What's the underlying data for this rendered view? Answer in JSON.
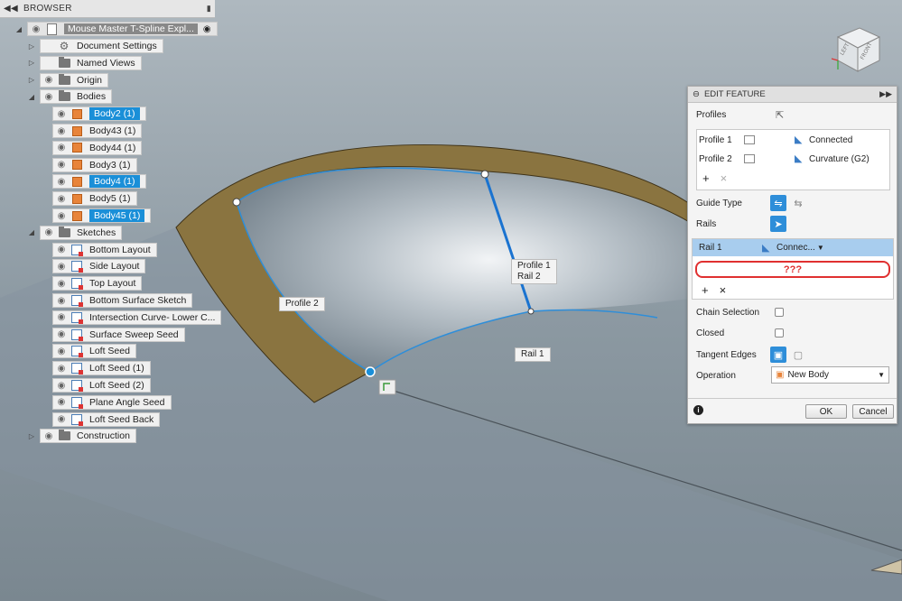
{
  "browser": {
    "title": "BROWSER",
    "collapse_icon": "double-left-arrow",
    "root_label": "Mouse Master T-Spline Expl...",
    "items": [
      {
        "label": "Document Settings",
        "type": "settings"
      },
      {
        "label": "Named Views",
        "type": "folder"
      },
      {
        "label": "Origin",
        "type": "folder"
      },
      {
        "label": "Bodies",
        "type": "folder"
      },
      {
        "label": "Body2 (1)",
        "type": "body",
        "selected": true
      },
      {
        "label": "Body43 (1)",
        "type": "body"
      },
      {
        "label": "Body44 (1)",
        "type": "body"
      },
      {
        "label": "Body3 (1)",
        "type": "body"
      },
      {
        "label": "Body4 (1)",
        "type": "body",
        "selected": true
      },
      {
        "label": "Body5 (1)",
        "type": "body"
      },
      {
        "label": "Body45 (1)",
        "type": "body",
        "selected": true
      },
      {
        "label": "Sketches",
        "type": "folder"
      },
      {
        "label": "Bottom Layout",
        "type": "sketch"
      },
      {
        "label": "Side Layout",
        "type": "sketch"
      },
      {
        "label": "Top Layout",
        "type": "sketch"
      },
      {
        "label": "Bottom Surface Sketch",
        "type": "sketch"
      },
      {
        "label": "Intersection Curve- Lower C...",
        "type": "sketch"
      },
      {
        "label": "Surface Sweep Seed",
        "type": "sketch"
      },
      {
        "label": "Loft Seed",
        "type": "sketch"
      },
      {
        "label": "Loft Seed (1)",
        "type": "sketch"
      },
      {
        "label": "Loft Seed (2)",
        "type": "sketch"
      },
      {
        "label": "Plane Angle Seed",
        "type": "sketch"
      },
      {
        "label": "Loft Seed Back",
        "type": "sketch"
      },
      {
        "label": "Construction",
        "type": "folder"
      }
    ]
  },
  "viewport": {
    "labels": {
      "profile1": "Profile 1",
      "rail2": "Rail 2",
      "profile2": "Profile 2",
      "rail1": "Rail 1"
    },
    "viewcube": {
      "left": "LEFT",
      "front": "FRONT"
    },
    "colors": {
      "surface_edge": "#2e8ed9",
      "wall": "#8a7440",
      "background": "#8d9aa3"
    }
  },
  "edit_feature": {
    "title": "EDIT FEATURE",
    "profiles_label": "Profiles",
    "profiles": [
      {
        "name": "Profile 1",
        "continuity": "Connected"
      },
      {
        "name": "Profile 2",
        "continuity": "Curvature (G2)"
      }
    ],
    "add_symbol": "+",
    "remove_symbol": "×",
    "guide_type_label": "Guide Type",
    "rails_label": "Rails",
    "rail_selected": {
      "name": "Rail 1",
      "continuity": "Connec..."
    },
    "rail_question": "???",
    "chain_selection_label": "Chain Selection",
    "closed_label": "Closed",
    "tangent_edges_label": "Tangent Edges",
    "operation_label": "Operation",
    "operation_value": "New Body",
    "ok_label": "OK",
    "cancel_label": "Cancel",
    "info_icon": "i"
  }
}
